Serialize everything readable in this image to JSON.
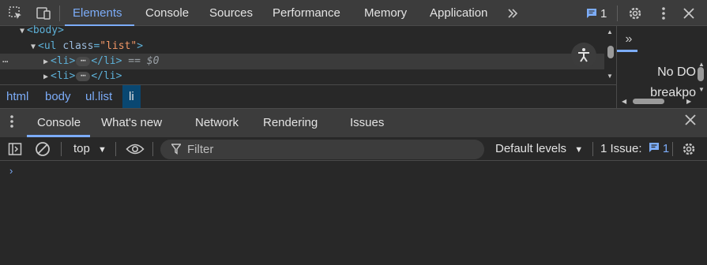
{
  "topbar": {
    "icons": [
      "inspect-element-icon",
      "device-toolbar-icon",
      "more-tabs-icon",
      "settings-icon",
      "kebab-menu-icon",
      "close-icon"
    ],
    "tabs": [
      {
        "label": "Elements",
        "active": true
      },
      {
        "label": "Console",
        "active": false
      },
      {
        "label": "Sources",
        "active": false
      },
      {
        "label": "Performance",
        "active": false
      },
      {
        "label": "Memory",
        "active": false
      },
      {
        "label": "Application",
        "active": false
      }
    ],
    "messages_count": "1"
  },
  "elements": {
    "rows": [
      {
        "open_tag": "<body>"
      },
      {
        "tag_open": "<ul ",
        "attr_name": "class",
        "attr_eq": "=",
        "attr_value": "\"list\"",
        "tag_close": ">"
      },
      {
        "open": "<li>",
        "ellipsis": "⋯",
        "close": "</li>",
        "eq_ref": " == $0"
      },
      {
        "open": "<li>",
        "ellipsis": "⋯",
        "close": "</li>"
      }
    ],
    "row_dots": "⋯"
  },
  "breadcrumbs": [
    {
      "label": "html",
      "active": false
    },
    {
      "label": "body",
      "active": false
    },
    {
      "label": "ul.list",
      "active": false
    },
    {
      "label": "li",
      "active": true
    }
  ],
  "sidepane": {
    "chevron": "»",
    "note_line1": "No DO",
    "note_line2": "breakpo"
  },
  "drawer": {
    "tabs": [
      {
        "label": "Console",
        "active": true
      },
      {
        "label": "What's new",
        "active": false
      },
      {
        "label": "Network",
        "active": false
      },
      {
        "label": "Rendering",
        "active": false
      },
      {
        "label": "Issues",
        "active": false
      }
    ]
  },
  "console_toolbar": {
    "context": "top",
    "filter_placeholder": "Filter",
    "levels": "Default levels",
    "issues_label": "1 Issue:",
    "issues_count": "1"
  },
  "console": {
    "prompt": "›"
  }
}
